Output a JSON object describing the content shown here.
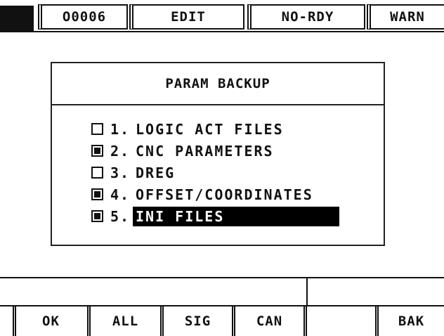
{
  "status_bar": {
    "program_number": "O0006",
    "mode": "EDIT",
    "ready_state": "NO-RDY",
    "alarm": "WARN"
  },
  "dialog": {
    "title": "PARAM BACKUP",
    "options": [
      {
        "number": "1.",
        "label": "LOGIC ACT FILES",
        "checked": false,
        "selected": false
      },
      {
        "number": "2.",
        "label": "CNC PARAMETERS",
        "checked": true,
        "selected": false
      },
      {
        "number": "3.",
        "label": "DREG",
        "checked": false,
        "selected": false
      },
      {
        "number": "4.",
        "label": "OFFSET/COORDINATES",
        "checked": true,
        "selected": false
      },
      {
        "number": "5.",
        "label": "INI FILES",
        "checked": true,
        "selected": true
      }
    ]
  },
  "message_area": {
    "left_text": "",
    "right_text": ""
  },
  "softkeys": [
    "OK",
    "ALL",
    "SIG",
    "CAN",
    "",
    "BAK"
  ],
  "colors": {
    "foreground": "#111111",
    "background": "#ffffff",
    "highlight_bg": "#000000",
    "highlight_fg": "#ffffff"
  }
}
